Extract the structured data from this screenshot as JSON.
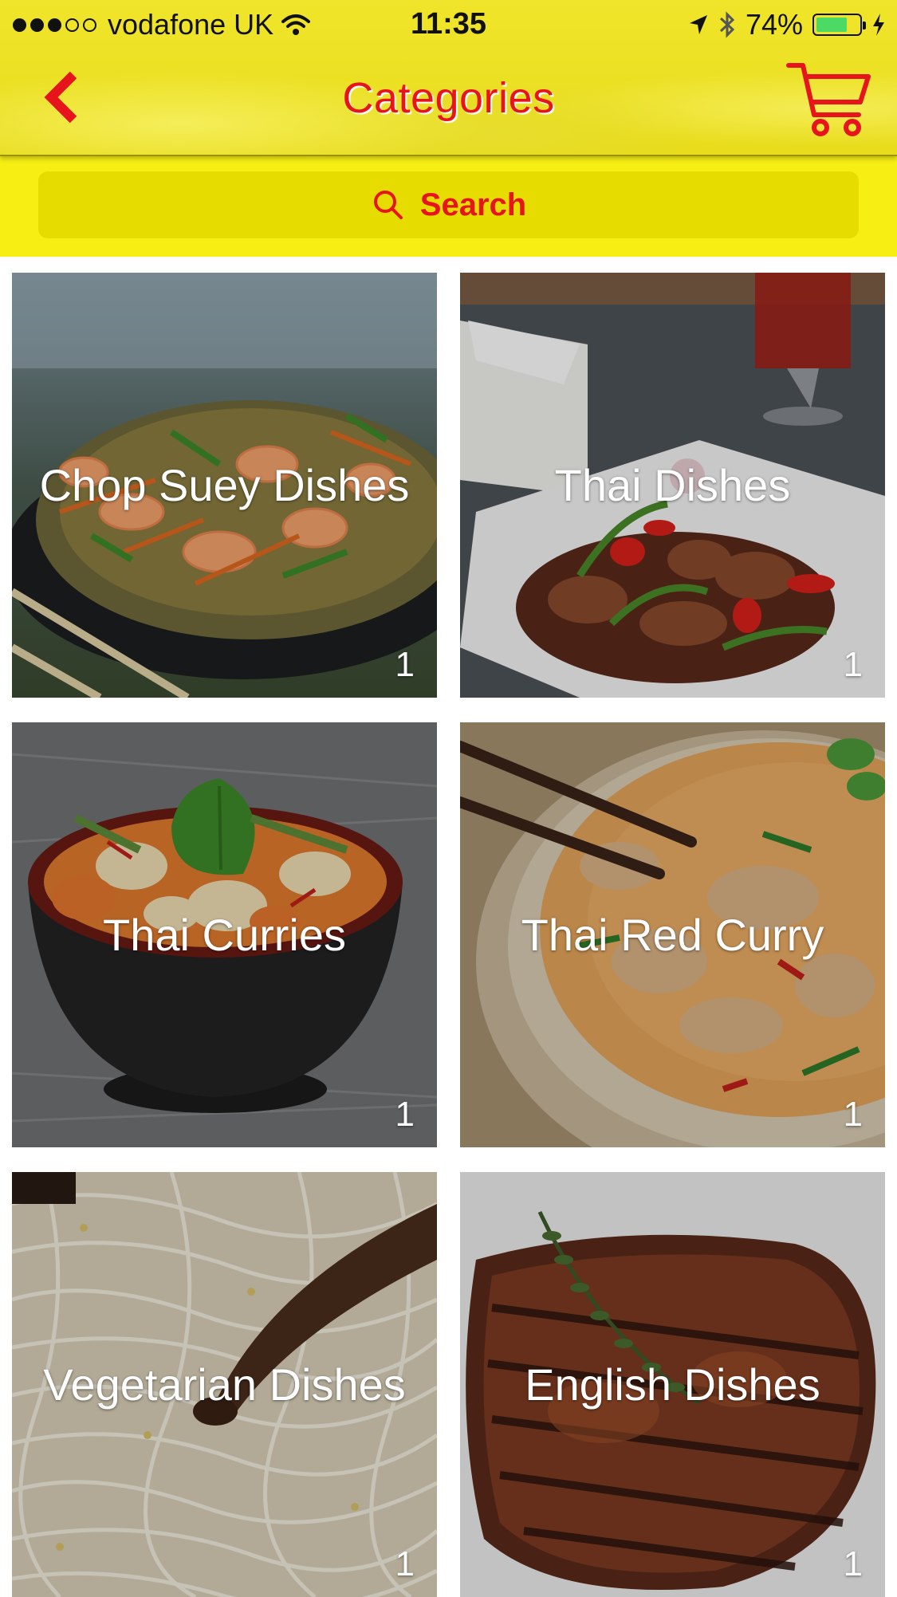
{
  "status_bar": {
    "carrier": "vodafone UK",
    "time": "11:35",
    "battery_percent": "74%",
    "battery_level": 0.74,
    "signal_bars_full": 3,
    "signal_bars_total": 5
  },
  "header": {
    "title": "Categories",
    "back_icon": "chevron-left-icon",
    "cart_icon": "cart-icon"
  },
  "search": {
    "label": "Search",
    "icon": "search-icon"
  },
  "colors": {
    "accent": "#e8141b",
    "header_yellow": "#f0e52a",
    "search_band": "#f7ef14",
    "search_box": "#e6dc00"
  },
  "categories": [
    {
      "name": "Chop Suey Dishes",
      "count": "1"
    },
    {
      "name": "Thai Dishes",
      "count": "1"
    },
    {
      "name": "Thai Curries",
      "count": "1"
    },
    {
      "name": "Thai Red Curry",
      "count": "1"
    },
    {
      "name": "Vegetarian Dishes",
      "count": "1"
    },
    {
      "name": "English Dishes",
      "count": "1"
    }
  ]
}
